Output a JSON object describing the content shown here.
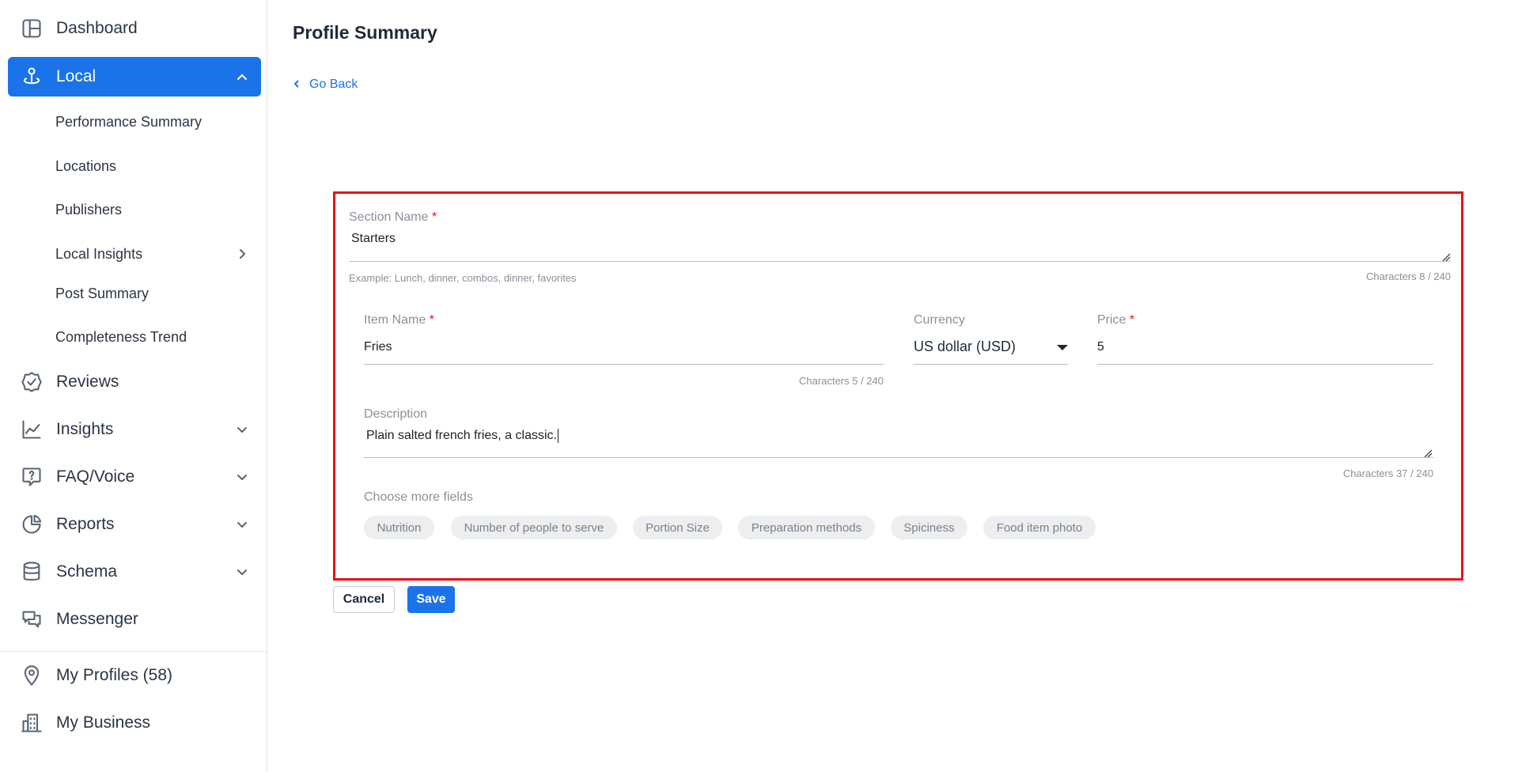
{
  "sidebar": {
    "dashboard": {
      "label": "Dashboard",
      "icon": "dashboard-icon"
    },
    "local": {
      "label": "Local",
      "icon": "local-pin-icon"
    },
    "local_sub": {
      "performance_summary": "Performance Summary",
      "locations": "Locations",
      "publishers": "Publishers",
      "local_insights": "Local Insights",
      "post_summary": "Post Summary",
      "completeness_trend": "Completeness Trend"
    },
    "reviews": {
      "label": "Reviews",
      "icon": "reviews-badge-icon"
    },
    "insights": {
      "label": "Insights",
      "icon": "line-chart-icon"
    },
    "faq_voice": {
      "label": "FAQ/Voice",
      "icon": "faq-icon"
    },
    "reports": {
      "label": "Reports",
      "icon": "pie-chart-icon"
    },
    "schema": {
      "label": "Schema",
      "icon": "database-icon"
    },
    "messenger": {
      "label": "Messenger",
      "icon": "chat-icon"
    },
    "my_profiles": {
      "label": "My Profiles (58)",
      "icon": "map-pin-icon"
    },
    "my_business": {
      "label": "My Business",
      "icon": "building-icon"
    }
  },
  "header": {
    "title": "Profile Summary",
    "go_back": "Go Back"
  },
  "form": {
    "section_name": {
      "label": "Section Name",
      "required_mark": "*",
      "value": "Starters",
      "hint": "Example: Lunch, dinner, combos, dinner, favorites",
      "counter": "Characters 8 / 240"
    },
    "item_name": {
      "label": "Item Name",
      "required_mark": "*",
      "value": "Fries",
      "counter": "Characters 5 / 240"
    },
    "currency": {
      "label": "Currency",
      "value": "US dollar (USD)"
    },
    "price": {
      "label": "Price",
      "required_mark": "*",
      "value": "5"
    },
    "description": {
      "label": "Description",
      "value": "Plain salted french fries, a classic.",
      "counter": "Characters 37 / 240"
    },
    "more_fields": {
      "label": "Choose more fields",
      "chips": [
        "Nutrition",
        "Number of people to serve",
        "Portion Size",
        "Preparation methods",
        "Spiciness",
        "Food item photo"
      ]
    }
  },
  "actions": {
    "cancel": "Cancel",
    "save": "Save"
  },
  "colors": {
    "accent": "#1a73e8",
    "highlight_border": "#e8111b"
  }
}
